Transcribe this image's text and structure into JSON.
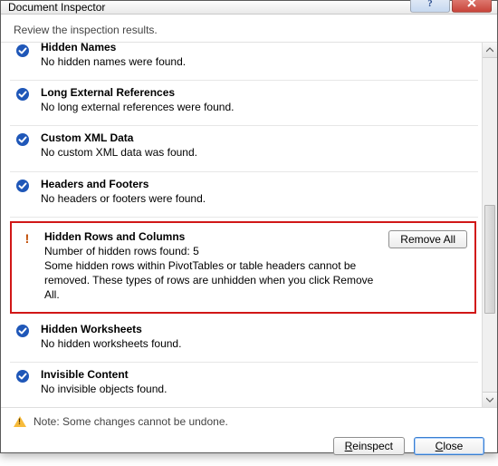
{
  "window": {
    "title": "Document Inspector"
  },
  "instruction": "Review the inspection results.",
  "items": {
    "hidden_names": {
      "title": "Hidden Names",
      "desc": "No hidden names were found."
    },
    "long_refs": {
      "title": "Long External References",
      "desc": "No long external references were found."
    },
    "custom_xml": {
      "title": "Custom XML Data",
      "desc": "No custom XML data was found."
    },
    "headers": {
      "title": "Headers and Footers",
      "desc": "No headers or footers were found."
    },
    "hidden_rc": {
      "title": "Hidden Rows and Columns",
      "line1": "Number of hidden rows found: 5",
      "line2": "Some hidden rows within PivotTables or table headers cannot be removed. These types of rows are unhidden when you click Remove All.",
      "action": "Remove All"
    },
    "hidden_ws": {
      "title": "Hidden Worksheets",
      "desc": "No hidden worksheets found."
    },
    "invisible": {
      "title": "Invisible Content",
      "desc": "No invisible objects found."
    }
  },
  "footer": {
    "note": "Note: Some changes cannot be undone.",
    "reinspect": "Reinspect",
    "close": "Close"
  }
}
